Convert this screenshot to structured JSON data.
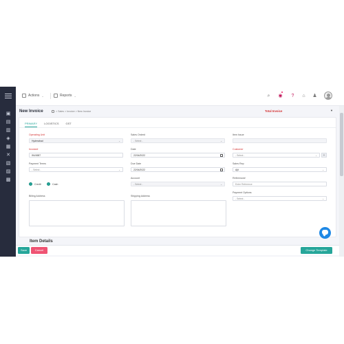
{
  "topbar": {
    "actions_label": "Actions",
    "reports_label": "Reports"
  },
  "header": {
    "title": "New Invoice",
    "breadcrumb": "> Sales > Invoice > New Invoice",
    "total_invoice": "Total Invoice"
  },
  "tabs": [
    "PRIMARY",
    "LOGISTICS",
    "GST"
  ],
  "form": {
    "operating_unit": {
      "label": "Operating Unit",
      "value": "Hyderabad"
    },
    "sales_order": {
      "label": "Sales Order#",
      "placeholder": "- Select -"
    },
    "item_issue": {
      "label": "Item Issue"
    },
    "invoice_no": {
      "label": "Invoice#",
      "value": "INV4587"
    },
    "date": {
      "label": "Date",
      "value": "22/04/2022"
    },
    "customer": {
      "label": "Customer",
      "placeholder": "- Select -"
    },
    "payment_terms": {
      "label": "Payment Terms",
      "placeholder": "- Select -"
    },
    "due_date": {
      "label": "Due Date",
      "value": "22/04/2022"
    },
    "sales_rep": {
      "label": "Sales Rep",
      "value": "Ajit"
    },
    "account": {
      "label": "Account",
      "placeholder": "- Select -"
    },
    "reference": {
      "label": "Reference#",
      "placeholder": "Enter Reference"
    },
    "mode_options": [
      "Credit",
      "Cash"
    ],
    "billing_address": {
      "label": "Billing Address"
    },
    "shipping_address": {
      "label": "Shipping Address"
    },
    "payment_options": {
      "label": "Payment Options",
      "placeholder": "- Select -"
    }
  },
  "item_details_heading": "Item Details",
  "footer": {
    "save_label": "Save",
    "cancel_label": "Cancel",
    "change_template_label": "Change Template"
  },
  "colors": {
    "accent": "#26a69a",
    "danger": "#ef5373",
    "required": "#d32f2f",
    "sidebar": "#272c3d",
    "chat": "#1e88e5"
  }
}
